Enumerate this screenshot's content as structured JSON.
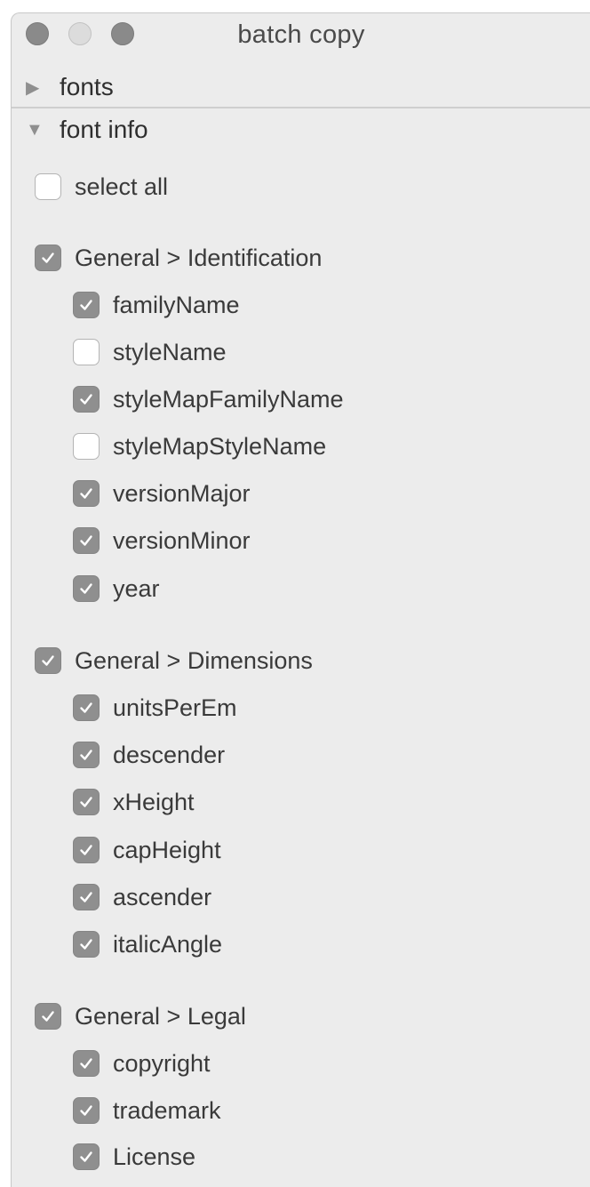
{
  "window": {
    "title": "batch copy"
  },
  "sections": {
    "fonts": {
      "label": "fonts",
      "expanded": false
    },
    "font_info": {
      "label": "font info",
      "expanded": true
    }
  },
  "select_all": {
    "label": "select all",
    "checked": false
  },
  "groups": {
    "identification": {
      "label": "General > Identification",
      "checked": true,
      "items": [
        {
          "label": "familyName",
          "checked": true
        },
        {
          "label": "styleName",
          "checked": false
        },
        {
          "label": "styleMapFamilyName",
          "checked": true
        },
        {
          "label": "styleMapStyleName",
          "checked": false
        },
        {
          "label": "versionMajor",
          "checked": true
        },
        {
          "label": "versionMinor",
          "checked": true
        },
        {
          "label": "year",
          "checked": true
        }
      ]
    },
    "dimensions": {
      "label": "General > Dimensions",
      "checked": true,
      "items": [
        {
          "label": "unitsPerEm",
          "checked": true
        },
        {
          "label": "descender",
          "checked": true
        },
        {
          "label": "xHeight",
          "checked": true
        },
        {
          "label": "capHeight",
          "checked": true
        },
        {
          "label": "ascender",
          "checked": true
        },
        {
          "label": "italicAngle",
          "checked": true
        }
      ]
    },
    "legal": {
      "label": "General > Legal",
      "checked": true,
      "items": [
        {
          "label": "copyright",
          "checked": true
        },
        {
          "label": "trademark",
          "checked": true
        },
        {
          "label": "License",
          "checked": true
        }
      ]
    }
  }
}
